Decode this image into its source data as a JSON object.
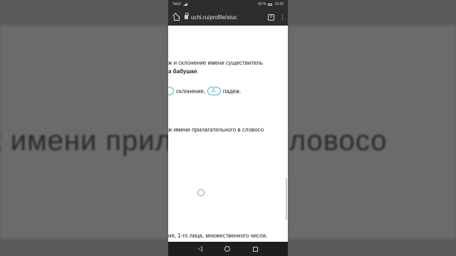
{
  "status_bar": {
    "carrier": "Tele2",
    "battery": "60 %",
    "time": "16:25"
  },
  "browser": {
    "url": "uchi.ru/profile/stuc",
    "tab_count": "8",
    "menu_glyph": "⋮"
  },
  "content": {
    "line1": "ж и склонение имени существитель",
    "line2": "а бабушке",
    "line2_end": ".",
    "line3_text1": "склонение,",
    "line3_pill": "Д.",
    "line3_text2": "падеж.",
    "line4": "ж имени прилагательного в словосо",
    "line5": "ия, 1-го лица, множественного числа."
  },
  "background": {
    "left_text": "еж имени прил",
    "right_text": "ного в словосо"
  },
  "colors": {
    "accent": "#4db6c8",
    "browser_bar": "#2d2d2d",
    "nav_bar": "#1e1e1e"
  }
}
